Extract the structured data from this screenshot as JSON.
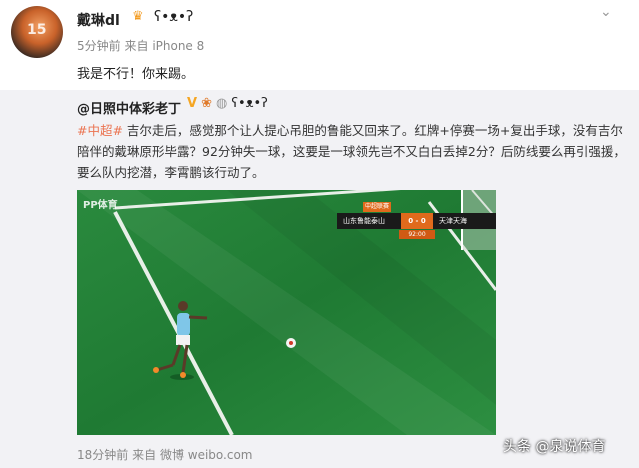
{
  "post": {
    "username": "戴琳dl",
    "badge_icon": "crown-icon",
    "emoji_icon": "panda-icon",
    "time": "5分钟前",
    "source_prefix": "来自",
    "source": "iPhone 8",
    "text": "我是不行！你来踢。"
  },
  "repost": {
    "username": "@日照中体彩老丁",
    "text_tag": "#中超#",
    "text_body": " 吉尔走后，感觉那个让人提心吊胆的鲁能又回来了。红牌+停赛一场+复出手球，没有吉尔陪伴的戴琳原形毕露？92分钟失一球，这要是一球领先岂不又白白丢掉2分？后防线要么再引强援，要么队内挖潜，李霄鹏该行动了。",
    "time": "18分钟前",
    "source_prefix": "来自",
    "source": "微博 weibo.com",
    "video": {
      "logo": "PP体育",
      "team1": "山东鲁能泰山",
      "score": "0 - 0",
      "team2": "天津天海",
      "league_tag": "中超联赛",
      "clock": "92:00"
    }
  },
  "watermark": "头条 @泉说体育",
  "colors": {
    "hashtag": "#eb7350",
    "pitch": "#1e7a34",
    "score_orange": "#e06a1c"
  }
}
